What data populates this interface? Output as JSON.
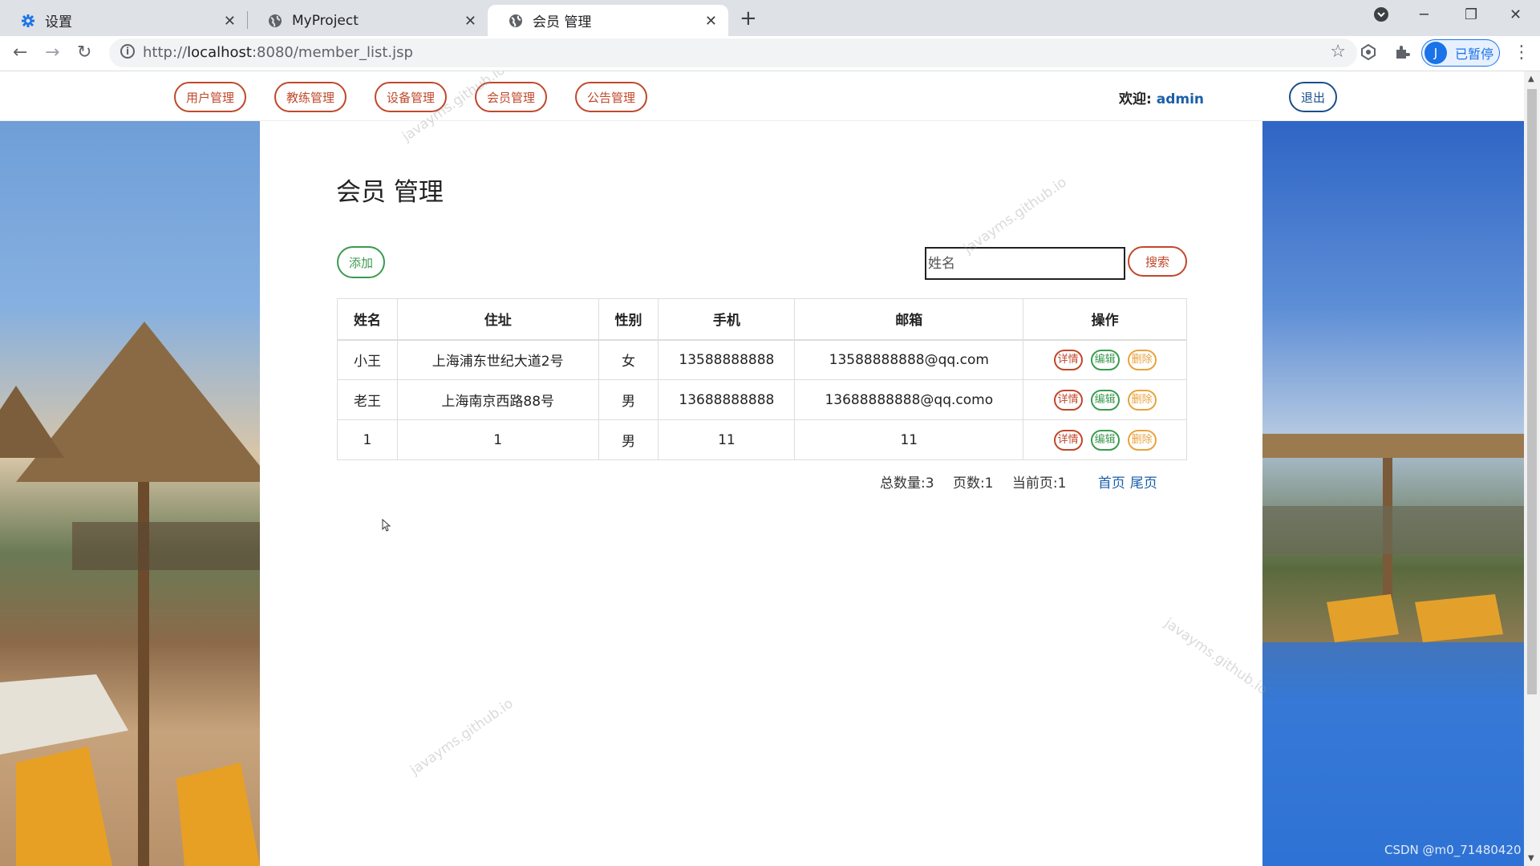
{
  "browser": {
    "tabs": [
      {
        "title": "设置",
        "icon": "gear-icon"
      },
      {
        "title": "MyProject",
        "icon": "globe-icon"
      },
      {
        "title": "会员 管理",
        "icon": "globe-icon",
        "active": true
      }
    ],
    "url_prefix": "http://",
    "url_host": "localhost",
    "url_rest": ":8080/member_list.jsp",
    "profile_initial": "J",
    "profile_label": "已暂停"
  },
  "topnav": {
    "items": [
      "用户管理",
      "教练管理",
      "设备管理",
      "会员管理",
      "公告管理"
    ],
    "welcome_label": "欢迎:",
    "username": "admin",
    "logout_label": "退出"
  },
  "page": {
    "title": "会员 管理",
    "add_label": "添加",
    "search_placeholder": "姓名",
    "search_label": "搜索"
  },
  "table": {
    "headers": [
      "姓名",
      "住址",
      "性别",
      "手机",
      "邮箱",
      "操作"
    ],
    "rows": [
      {
        "name": "小王",
        "address": "上海浦东世纪大道2号",
        "gender": "女",
        "phone": "13588888888",
        "email": "13588888888@qq.com"
      },
      {
        "name": "老王",
        "address": "上海南京西路88号",
        "gender": "男",
        "phone": "13688888888",
        "email": "13688888888@qq.como"
      },
      {
        "name": "1",
        "address": "1",
        "gender": "男",
        "phone": "11",
        "email": "11"
      }
    ],
    "actions": {
      "detail": "详情",
      "edit": "编辑",
      "delete": "删除"
    }
  },
  "pager": {
    "total": "总数量:3",
    "pages": "页数:1",
    "current": "当前页:1",
    "first": "首页",
    "last": "尾页"
  },
  "watermark": "javayms.github.io",
  "credit": "CSDN @m0_71480420",
  "colors": {
    "accent_red": "#c0482b",
    "accent_green": "#3b9a4f",
    "accent_orange": "#e8a33d",
    "accent_blue": "#1b5fa8"
  }
}
